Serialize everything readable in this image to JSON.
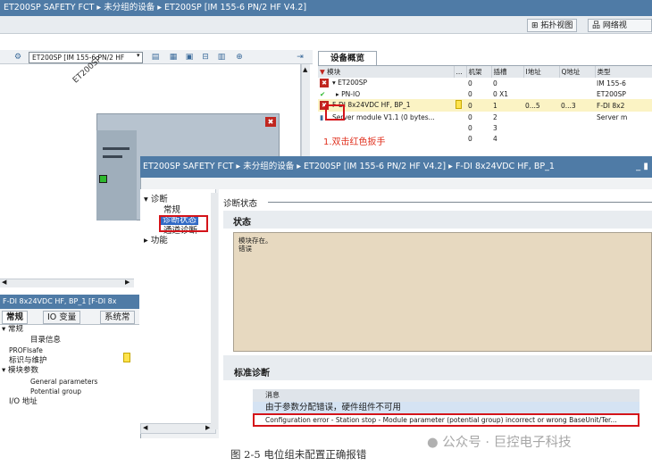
{
  "window": {
    "breadcrumb": "ET200SP SAFETY FCT  ▸  未分组的设备  ▸  ET200SP [IM 155-6 PN/2 HF V4.2]"
  },
  "view_tabs": {
    "topology": "拓扑视图",
    "network": "网络视"
  },
  "left_toolbar": {
    "device_selector": "ET200SP [IM 155-6 PN/2 HF"
  },
  "canvas": {
    "device_label": "ET200SP"
  },
  "device_overview": {
    "tab_label": "设备概览",
    "columns": [
      "模块",
      "...",
      "机架",
      "插槽",
      "I地址",
      "Q地址",
      "类型"
    ],
    "rows": [
      {
        "module": "▾ ET200SP",
        "dots": "",
        "rack": "0",
        "slot": "0",
        "i_addr": "",
        "q_addr": "",
        "type": "IM 155-6"
      },
      {
        "module": "▸ PN-IO",
        "dots": "",
        "rack": "0",
        "slot": "0 X1",
        "i_addr": "",
        "q_addr": "",
        "type": "ET200SP"
      },
      {
        "module": "F-DI 8x24VDC HF, BP_1",
        "dots": "",
        "rack": "0",
        "slot": "1",
        "i_addr": "0...5",
        "q_addr": "0...3",
        "type": "F-DI 8x2"
      },
      {
        "module": "Server module V1.1 (0 bytes...",
        "dots": "",
        "rack": "0",
        "slot": "2",
        "i_addr": "",
        "q_addr": "",
        "type": "Server m"
      },
      {
        "module": "",
        "dots": "",
        "rack": "0",
        "slot": "3",
        "i_addr": "",
        "q_addr": "",
        "type": ""
      },
      {
        "module": "",
        "dots": "",
        "rack": "0",
        "slot": "4",
        "i_addr": "",
        "q_addr": "",
        "type": ""
      }
    ]
  },
  "annotation": "1.双击红色扳手",
  "properties": {
    "title": "F-DI 8x24VDC HF, BP_1 [F-DI 8x",
    "tabs": [
      "常规",
      "IO 变量",
      "系统常"
    ],
    "nav": [
      "▾ 常规",
      "目录信息",
      "PROFIsafe",
      "标识与维护",
      "▾ 模块参数",
      "General parameters",
      "Potential group",
      "I/O 地址"
    ]
  },
  "diag_dialog": {
    "title": "ET200SP SAFETY FCT  ▸  未分组的设备  ▸  ET200SP [IM 155-6 PN/2 HF V4.2]  ▸  F-DI 8x24VDC HF, BP_1",
    "close": "_ ▮",
    "nav": {
      "diag": "▾ 诊断",
      "general": "常规",
      "diag_status": "诊断状态",
      "channel_diag": "通道诊断",
      "functions": "▸ 功能"
    },
    "section_header": "诊断状态",
    "status_title": "状态",
    "status_lines": [
      "模块存在。",
      "错误"
    ],
    "std_title": "标准诊断",
    "msg_header": "消息",
    "msg_cn": "由于参数分配错误，硬件组件不可用",
    "msg_en": "Configuration error - Station stop - Module parameter (potential group) incorrect or wrong BaseUnit/Ter..."
  },
  "watermark": "公众号 · 巨控电子科技",
  "caption": "图 2-5  电位组未配置正确报错",
  "colors": {
    "title_bar": "#4f7ba6",
    "error_red": "#d4141a",
    "status_bg": "#e7d9c0",
    "ok_green": "#2eb82e"
  }
}
